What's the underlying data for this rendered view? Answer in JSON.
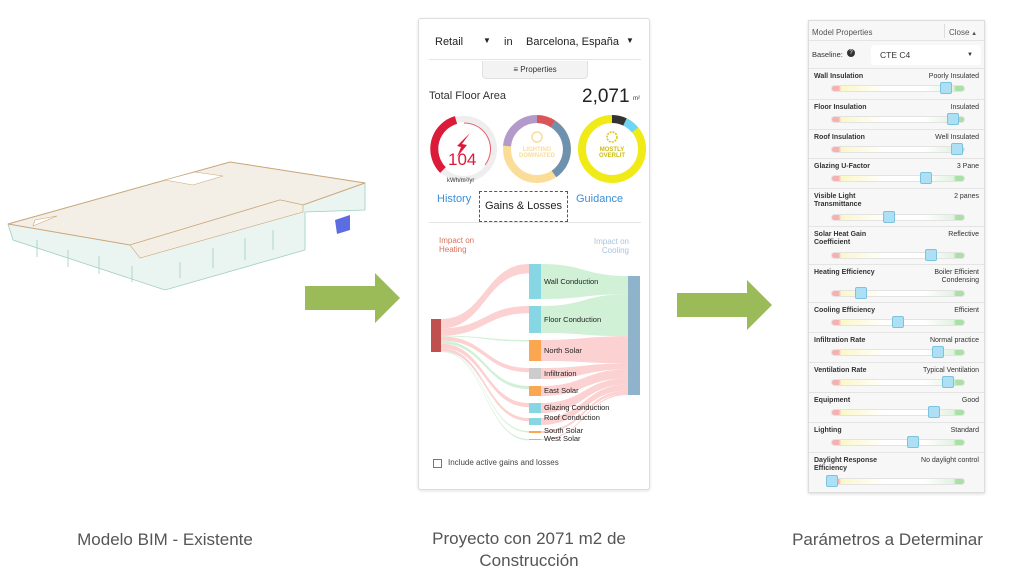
{
  "captions": {
    "left": "Modelo BIM -  Existente",
    "middle": "Proyecto con 2071 m2 de Construcción",
    "right": "Parámetros a Determinar"
  },
  "panel": {
    "building_type": "Retail",
    "in_label": "in",
    "location": "Barcelona, España",
    "properties_button": "Properties",
    "floor_area_label": "Total Floor Area",
    "floor_area_value": "2,071",
    "floor_area_unit": "m²",
    "eui_value": "104",
    "eui_unit": "kWh/m²/yr",
    "lighting_badge": "LIGHTING DOMINATED",
    "daylight_badge": "MOSTLY OVERLIT",
    "tabs": [
      {
        "label": "History",
        "active": false
      },
      {
        "label": "Gains & Losses",
        "active": true
      },
      {
        "label": "Guidance",
        "active": false
      }
    ],
    "sankey": {
      "left_title": "Impact on Heating",
      "right_title": "Impact on Cooling",
      "nodes": [
        "Wall Conduction",
        "Floor Conduction",
        "North Solar",
        "Infiltration",
        "East Solar",
        "Glazing Conduction",
        "Roof Conduction",
        "South Solar",
        "West Solar"
      ]
    },
    "checkbox_label": "Include active gains and losses",
    "checkbox_checked": false,
    "colors": {
      "heating": "#c0504d",
      "cooling": "#8fb3cb",
      "conduction": "#86d6e3",
      "solar": "#fba651",
      "infiltration": "#cccccc",
      "loss_flow": "#fcc9c9",
      "gain_flow": "#c9eed0"
    }
  },
  "props": {
    "title": "Model Properties",
    "close": "Close",
    "baseline_label": "Baseline:",
    "baseline_value": "CTE C4",
    "rows": [
      {
        "label": "Wall Insulation",
        "value": "Poorly Insulated",
        "level": 0.86
      },
      {
        "label": "Floor Insulation",
        "value": "Insulated",
        "level": 0.92
      },
      {
        "label": "Roof Insulation",
        "value": "Well Insulated",
        "level": 0.95
      },
      {
        "label": "Glazing U-Factor",
        "value": "3 Pane",
        "level": 0.71
      },
      {
        "label": "Visible Light Transmittance",
        "value": "2 panes",
        "level": 0.43
      },
      {
        "label": "Solar Heat Gain Coefficient",
        "value": "Reflective",
        "level": 0.75
      },
      {
        "label": "Heating Efficiency",
        "value": "Boiler Efficient Condensing",
        "level": 0.22
      },
      {
        "label": "Cooling Efficiency",
        "value": "Efficient",
        "level": 0.5
      },
      {
        "label": "Infiltration Rate",
        "value": "Normal practice",
        "level": 0.8
      },
      {
        "label": "Ventilation Rate",
        "value": "Typical Ventilation",
        "level": 0.88
      },
      {
        "label": "Equipment",
        "value": "Good",
        "level": 0.77
      },
      {
        "label": "Lighting",
        "value": "Standard",
        "level": 0.61
      },
      {
        "label": "Daylight Response Efficiency",
        "value": "No daylight control",
        "level": 0.0
      }
    ]
  },
  "arrow_color": "#9bbb59"
}
